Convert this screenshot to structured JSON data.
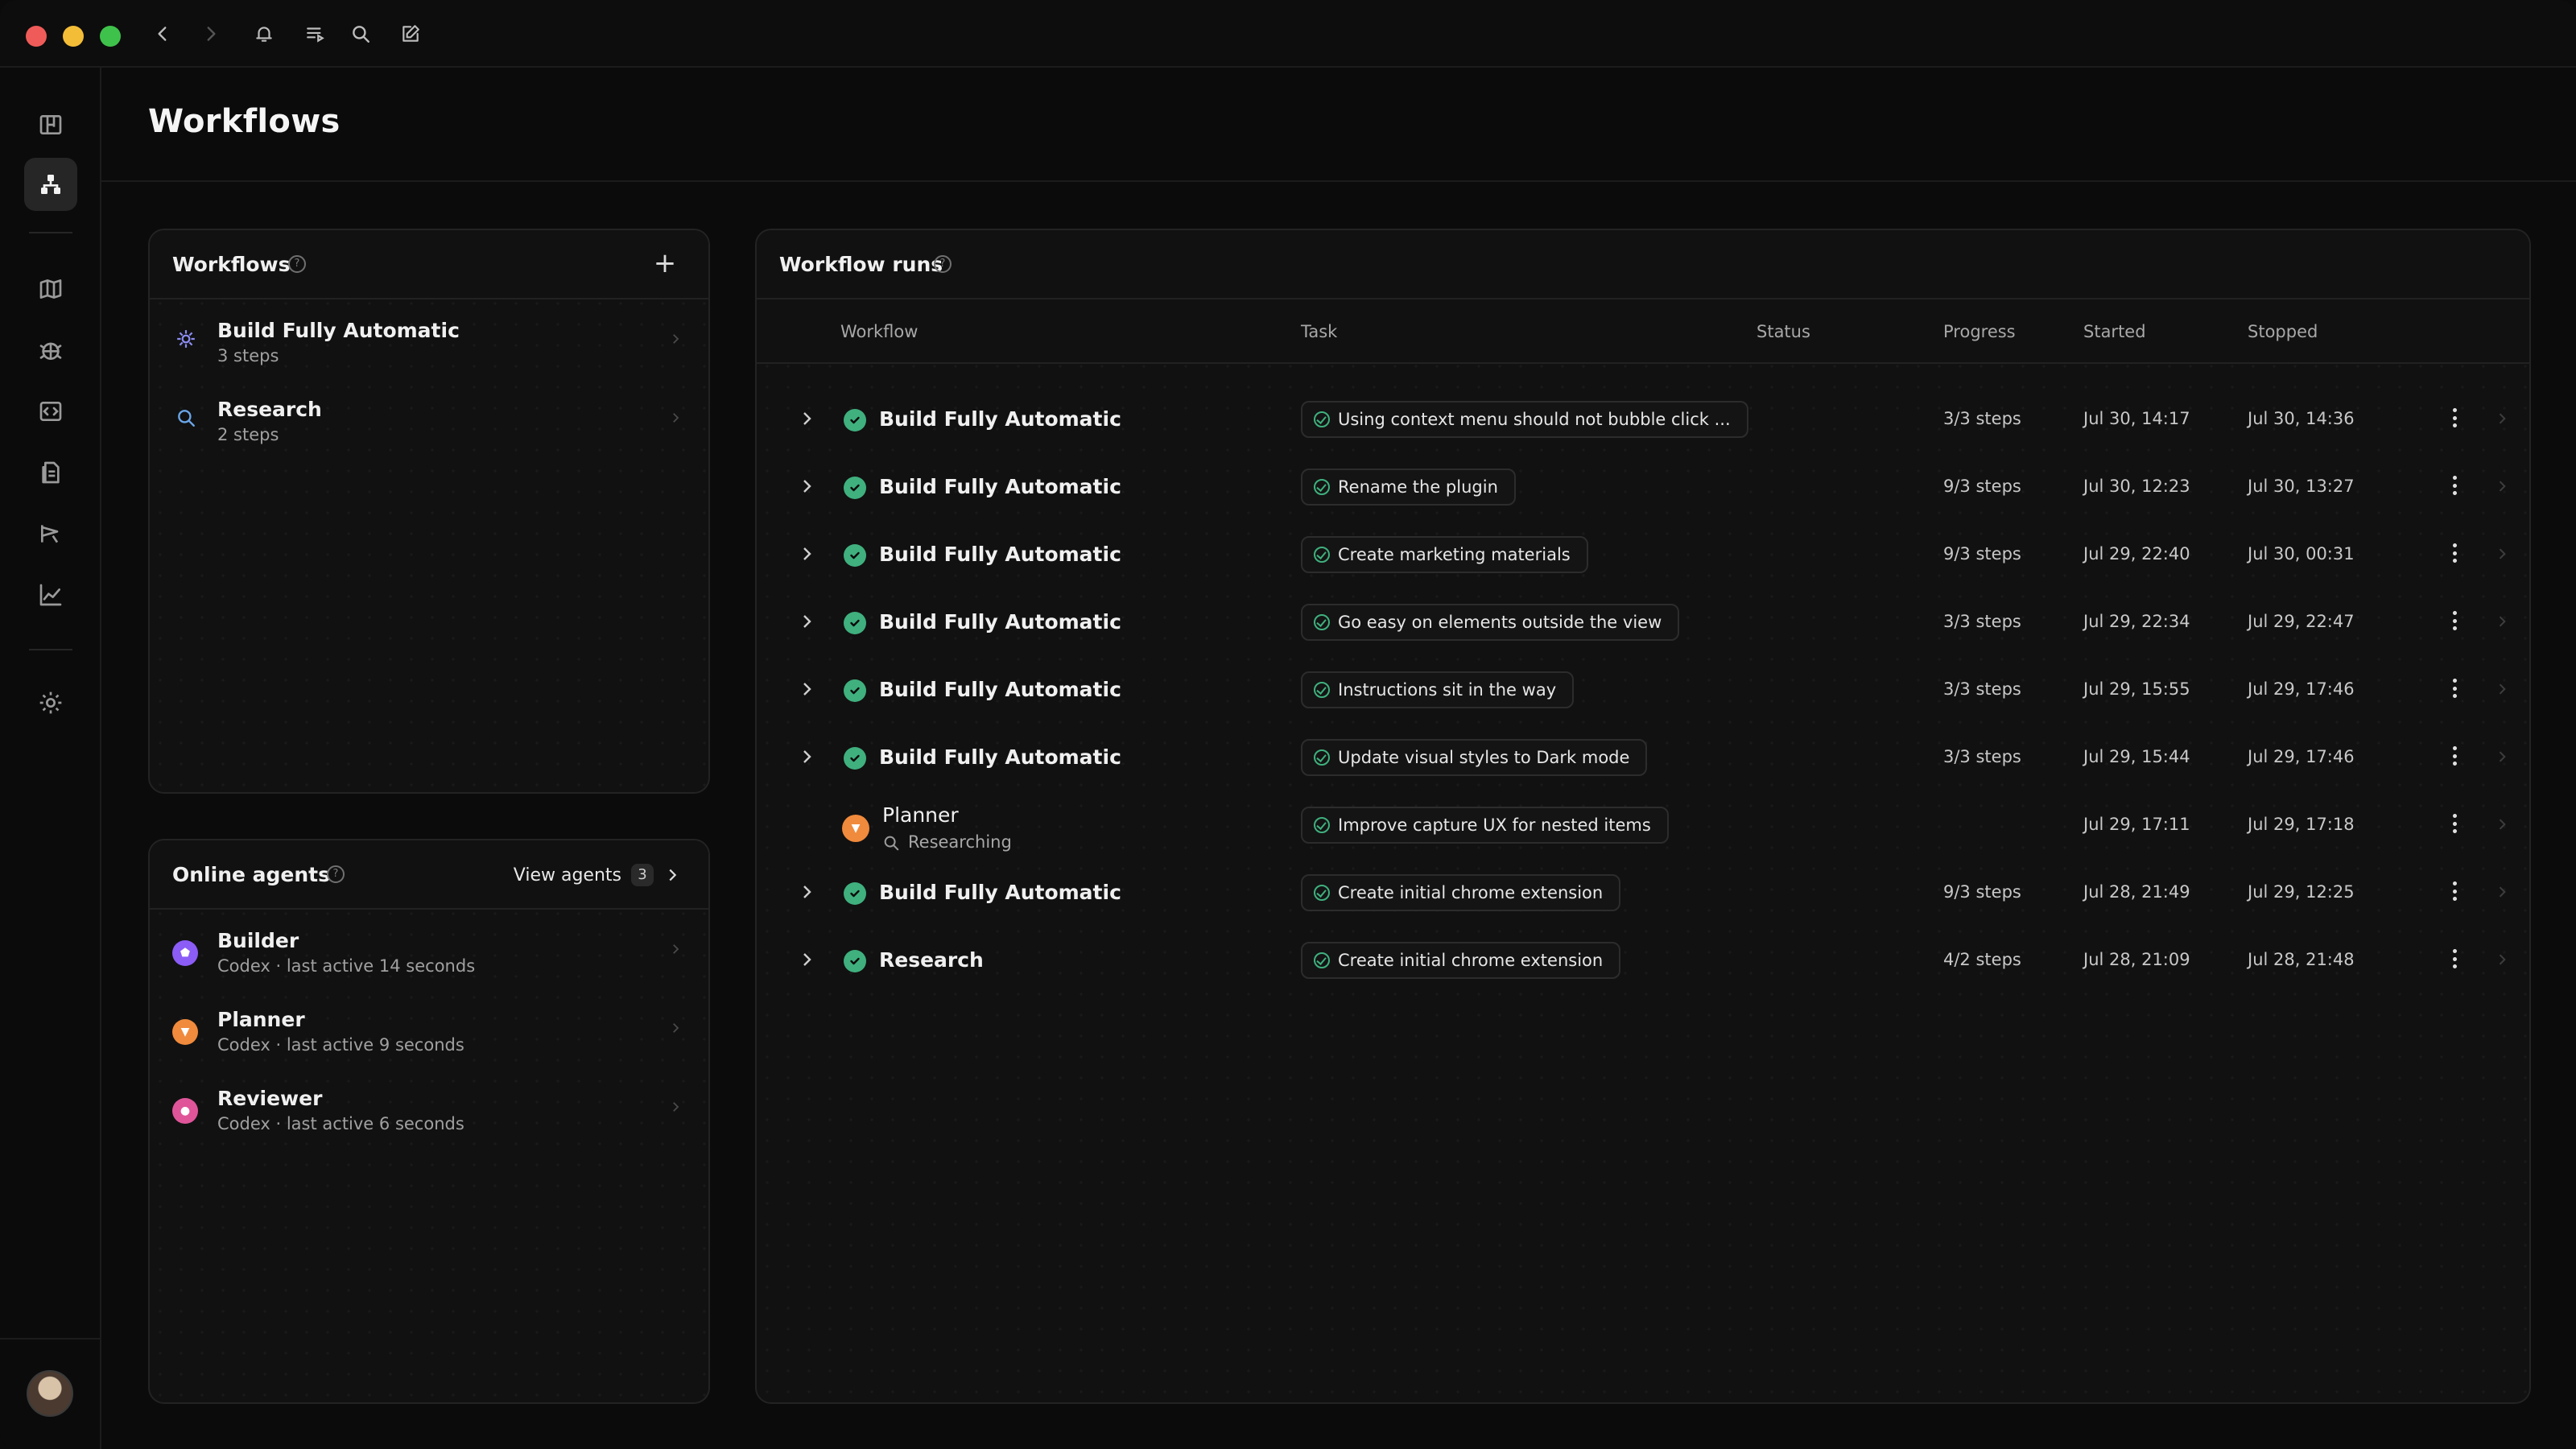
{
  "page": {
    "title": "Workflows"
  },
  "titlebar": {
    "icons": [
      "back-icon",
      "forward-icon",
      "bell-icon",
      "queue-icon",
      "search-icon",
      "compose-icon"
    ]
  },
  "sidebar": {
    "icons": [
      "board-icon",
      "workflow-icon",
      "map-icon",
      "bug-icon",
      "code-icon",
      "docs-icon",
      "megaphone-icon",
      "chart-icon",
      "settings-icon"
    ],
    "active": "workflow-icon"
  },
  "workflows_panel": {
    "title": "Workflows",
    "items": [
      {
        "name": "Build Fully Automatic",
        "steps": "3 steps",
        "icon": "gear-icon"
      },
      {
        "name": "Research",
        "steps": "2 steps",
        "icon": "search-icon"
      }
    ]
  },
  "agents_panel": {
    "title": "Online agents",
    "view_label": "View agents",
    "count": "3",
    "agents": [
      {
        "name": "Builder",
        "status": "Codex · last active 14 seconds",
        "color": "#8b5cf6"
      },
      {
        "name": "Planner",
        "status": "Codex · last active 9 seconds",
        "color": "#f08a3c"
      },
      {
        "name": "Reviewer",
        "status": "Codex · last active 6 seconds",
        "color": "#e0559a"
      }
    ]
  },
  "runs": {
    "title": "Workflow runs",
    "columns": {
      "workflow": "Workflow",
      "task": "Task",
      "status": "Status",
      "progress": "Progress",
      "started": "Started",
      "stopped": "Stopped"
    },
    "rows": [
      {
        "workflow": "Build Fully Automatic",
        "task": "Using context menu should not bubble click ...",
        "progress": "3/3 steps",
        "started": "Jul 30, 14:17",
        "stopped": "Jul 30, 14:36"
      },
      {
        "workflow": "Build Fully Automatic",
        "task": "Rename the plugin",
        "progress": "9/3 steps",
        "started": "Jul 30, 12:23",
        "stopped": "Jul 30, 13:27"
      },
      {
        "workflow": "Build Fully Automatic",
        "task": "Create marketing materials",
        "progress": "9/3 steps",
        "started": "Jul 29, 22:40",
        "stopped": "Jul 30, 00:31"
      },
      {
        "workflow": "Build Fully Automatic",
        "task": "Go easy on elements outside the view",
        "progress": "3/3 steps",
        "started": "Jul 29, 22:34",
        "stopped": "Jul 29, 22:47"
      },
      {
        "workflow": "Build Fully Automatic",
        "task": "Instructions sit in the way",
        "progress": "3/3 steps",
        "started": "Jul 29, 15:55",
        "stopped": "Jul 29, 17:46"
      },
      {
        "workflow": "Build Fully Automatic",
        "task": "Update visual styles to Dark mode",
        "progress": "3/3 steps",
        "started": "Jul 29, 15:44",
        "stopped": "Jul 29, 17:46"
      },
      {
        "agent": "Planner",
        "agent_status": "Researching",
        "task": "Improve capture UX for nested items",
        "progress": "",
        "started": "Jul 29, 17:11",
        "stopped": "Jul 29, 17:18"
      },
      {
        "workflow": "Build Fully Automatic",
        "task": "Create initial chrome extension",
        "progress": "9/3 steps",
        "started": "Jul 28, 21:49",
        "stopped": "Jul 29, 12:25"
      },
      {
        "workflow": "Research",
        "task": "Create initial chrome extension",
        "progress": "4/2 steps",
        "started": "Jul 28, 21:09",
        "stopped": "Jul 28, 21:48"
      }
    ]
  }
}
